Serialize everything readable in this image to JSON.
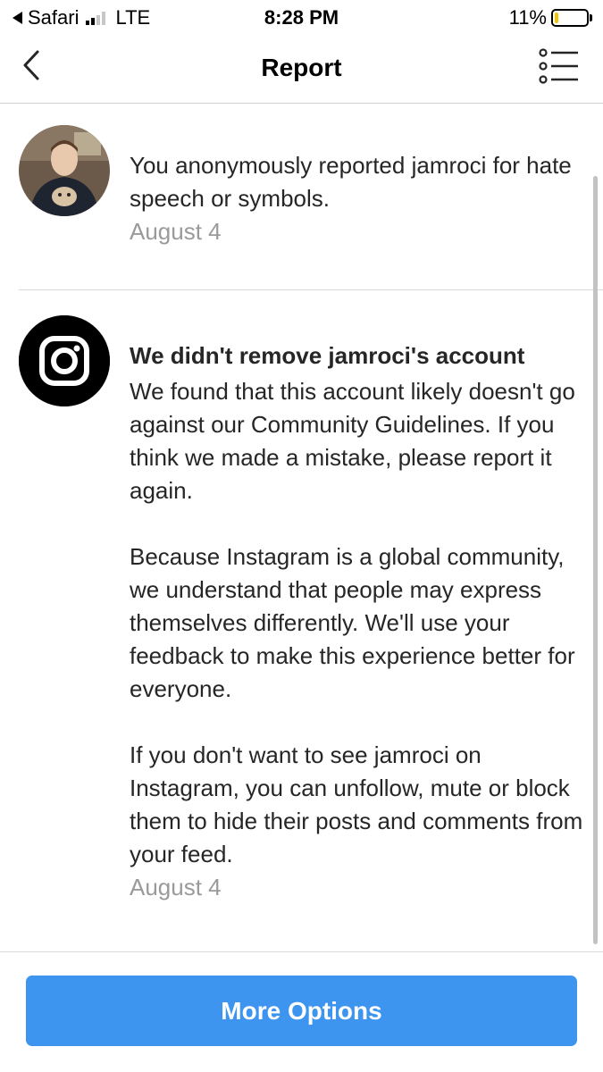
{
  "status_bar": {
    "carrier_app": "Safari",
    "network": "LTE",
    "time": "8:28 PM",
    "battery_percent": "11%",
    "battery_level": 0.11,
    "signal_bars_active": 2,
    "signal_bars_total": 4
  },
  "nav": {
    "title": "Report",
    "back_icon": "chevron-left-icon",
    "menu_icon": "list-menu-icon"
  },
  "items": [
    {
      "text": "You anonymously reported jamroci for hate speech or symbols.",
      "date": "August 4"
    },
    {
      "headline": "We didn't remove jamroci's account",
      "paragraphs": [
        "We found that this account likely doesn't go against our Community Guidelines. If you think we made a mistake, please report it again.",
        "Because Instagram is a global community, we understand that people may express themselves differently. We'll use your feedback to make this experience better for everyone.",
        "If you don't want to see jamroci on Instagram, you can unfollow, mute or block them to hide their posts and comments from your feed."
      ],
      "date": "August 4"
    }
  ],
  "footer": {
    "more_options_label": "More Options"
  },
  "colors": {
    "accent": "#3d95f0",
    "battery_low": "#f4c300",
    "secondary_text": "#9a9a9a"
  }
}
